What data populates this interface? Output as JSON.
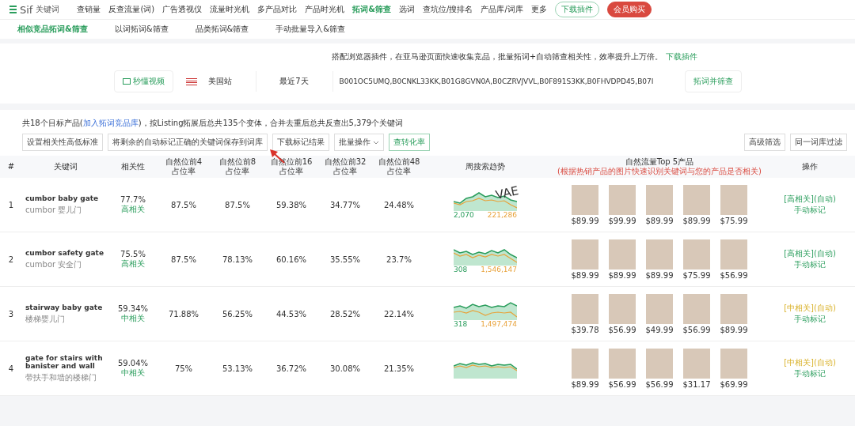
{
  "brand": {
    "name": "Sif",
    "sub": "关键词"
  },
  "nav": [
    {
      "label": "查销量",
      "selected": false
    },
    {
      "label": "反查流量(词)",
      "selected": false
    },
    {
      "label": "广告透视仪",
      "selected": false
    },
    {
      "label": "流量时光机",
      "selected": false
    },
    {
      "label": "多产品对比",
      "selected": false
    },
    {
      "label": "产品时光机",
      "selected": false
    },
    {
      "label": "拓词&筛查",
      "selected": true
    },
    {
      "label": "选词",
      "selected": false
    },
    {
      "label": "查坑位/搜排名",
      "selected": false
    },
    {
      "label": "产品库/词库",
      "selected": false
    },
    {
      "label": "更多",
      "selected": false
    }
  ],
  "download_plugin_button": "下载插件",
  "buy_button": "会员购买",
  "subtabs": [
    {
      "label": "相似竞品拓词&筛查",
      "selected": true
    },
    {
      "label": "以词拓词&筛查",
      "selected": false
    },
    {
      "label": "品类拓词&筛查",
      "selected": false
    },
    {
      "label": "手动批量导入&筛查",
      "selected": false
    }
  ],
  "search": {
    "hint": "搭配浏览器插件，在亚马逊页面快速收集竞品，批量拓词+自动筛查相关性，效率提升上万倍。",
    "hint_link": "下载插件",
    "video_button": "秒懂视频",
    "marketplace": "美国站",
    "period": "最近7天",
    "asins": "B001OC5UMQ,B0CNKL33KK,B01G8GVN0A,B0CZRVJVVL,B0F891S3KK,B0FHVDPD45,B07I",
    "submit": "拓词并筛查"
  },
  "summary": {
    "before": "共18个目标产品(",
    "link": "加入拓词竞品库",
    "after": ")，按Listing拓展后总共135个变体，合并去重后总共反查出5,379个关键词"
  },
  "actions": [
    "设置相关性高低标准",
    "将剩余的自动标记正确的关键词保存到词库",
    "下载标记结果"
  ],
  "batch": "批量操作",
  "conversion_button": "查转化率",
  "filters": [
    "高级筛选",
    "同一词库过滤"
  ],
  "table": {
    "columns": [
      "#",
      "关键词",
      "相关性",
      [
        "自然位前4",
        "占位率"
      ],
      [
        "自然位前8",
        "占位率"
      ],
      [
        "自然位前16",
        "占位率"
      ],
      [
        "自然位前32",
        "占位率"
      ],
      [
        "自然位前48",
        "占位率"
      ],
      "周搜索趋势",
      "自然流量Top 5产品",
      "操作"
    ],
    "top5_note": "(根据热销产品的图片快速识别关键词与您的产品是否相关)",
    "rows": [
      {
        "index": "1",
        "keyword": "cumbor baby gate",
        "translation": "cumbor 婴儿门",
        "relevance": "77.7%",
        "relevance_label": "高相关",
        "p4": "87.5%",
        "p8": "87.5%",
        "p16": "59.38%",
        "p32": "34.77%",
        "p48": "24.48%",
        "trend_low": "2,070",
        "trend_high": "221,286",
        "prices": [
          "$89.99",
          "$99.99",
          "$89.99",
          "$89.99",
          "$75.99"
        ],
        "kind": "high",
        "mark": "[高相关](自动)",
        "manual": "手动标记"
      },
      {
        "index": "2",
        "keyword": "cumbor safety gate",
        "translation": "cumbor 安全门",
        "relevance": "75.5%",
        "relevance_label": "高相关",
        "p4": "87.5%",
        "p8": "78.13%",
        "p16": "60.16%",
        "p32": "35.55%",
        "p48": "23.7%",
        "trend_low": "308",
        "trend_high": "1,546,147",
        "prices": [
          "$89.99",
          "$89.99",
          "$89.99",
          "$75.99",
          "$56.99"
        ],
        "kind": "high",
        "mark": "[高相关](自动)",
        "manual": "手动标记"
      },
      {
        "index": "3",
        "keyword": "stairway baby gate",
        "translation": "楼梯婴儿门",
        "relevance": "59.34%",
        "relevance_label": "中相关",
        "p4": "71.88%",
        "p8": "56.25%",
        "p16": "44.53%",
        "p32": "28.52%",
        "p48": "22.14%",
        "trend_low": "318",
        "trend_high": "1,497,474",
        "prices": [
          "$39.78",
          "$56.99",
          "$49.99",
          "$56.99",
          "$89.99"
        ],
        "kind": "medium",
        "mark": "[中相关](自动)",
        "manual": "手动标记"
      },
      {
        "index": "4",
        "keyword": "gate for stairs with banister and wall",
        "translation": "带扶手和墙的楼梯门",
        "relevance": "59.04%",
        "relevance_label": "中相关",
        "p4": "75%",
        "p8": "53.13%",
        "p16": "36.72%",
        "p32": "30.08%",
        "p48": "21.35%",
        "prices": [
          "$89.99",
          "$56.99",
          "$56.99",
          "$31.17",
          "$69.99"
        ],
        "kind": "medium",
        "mark": "[中相关](自动)",
        "manual": "手动标记"
      }
    ]
  },
  "annotation": "VAE"
}
